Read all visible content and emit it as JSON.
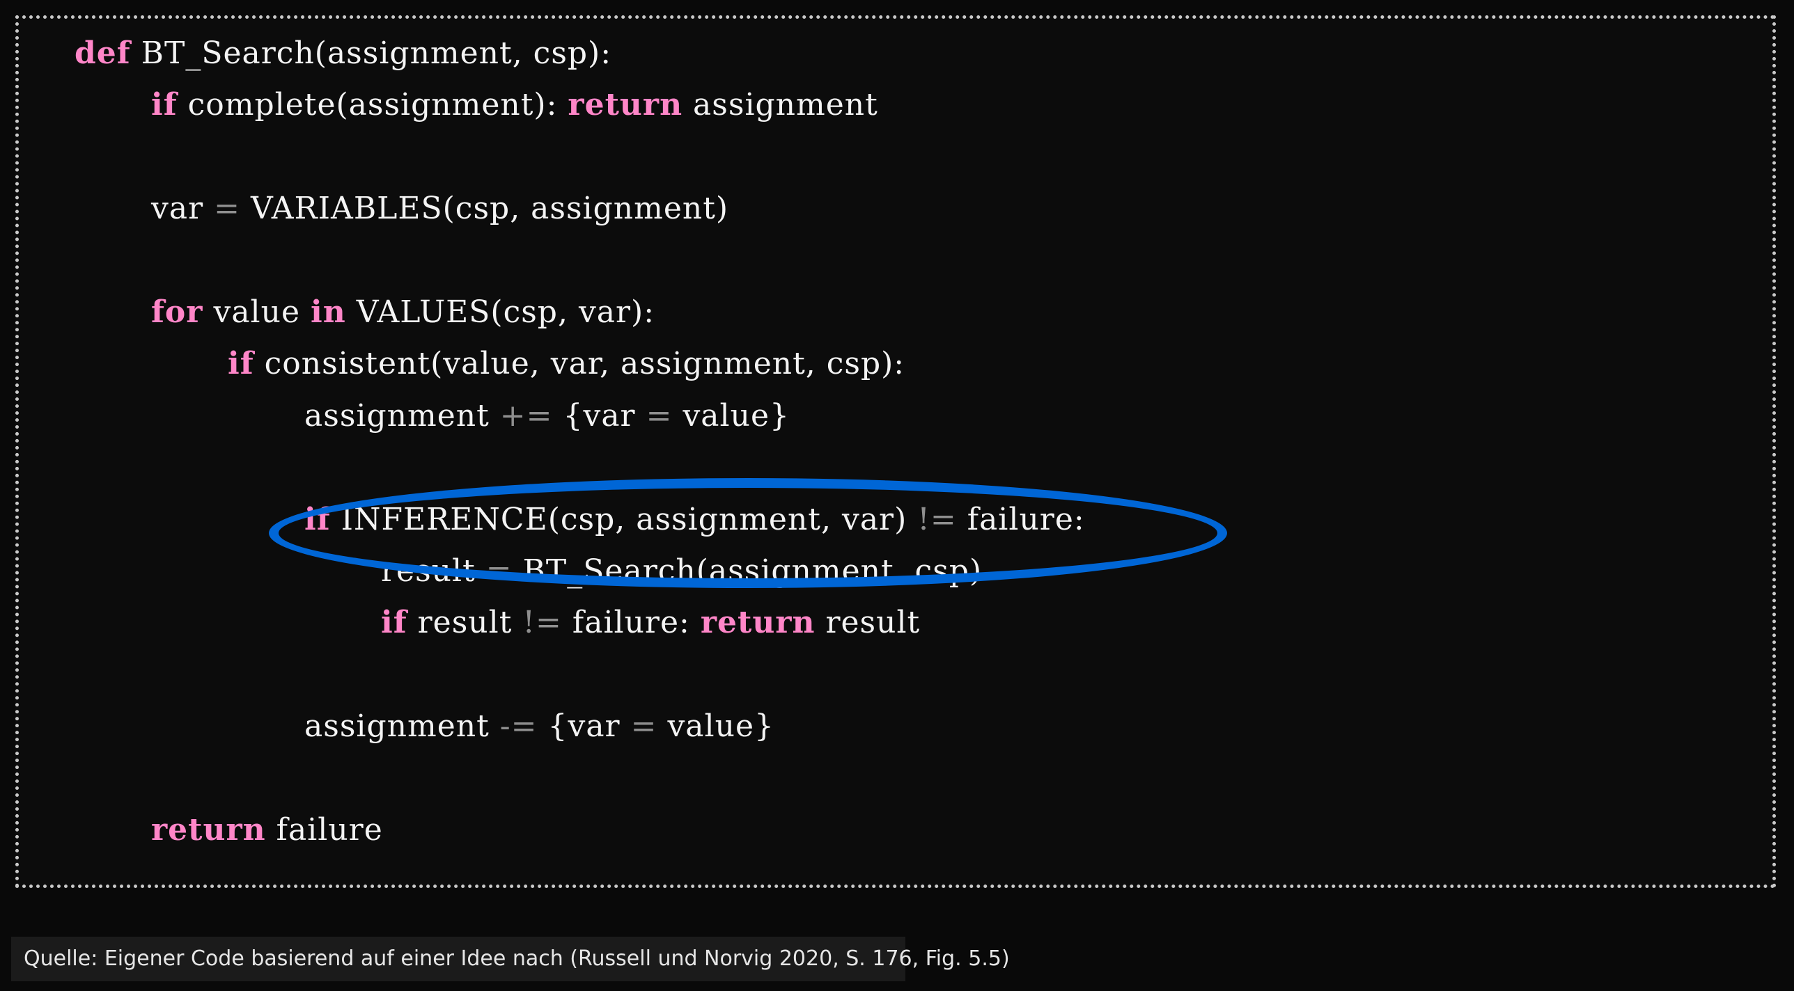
{
  "code": {
    "lines": [
      {
        "indent": 0,
        "tokens": [
          {
            "t": "kw",
            "text": "def"
          },
          {
            "t": "tx",
            "text": " BT_Search(assignment, csp):"
          }
        ]
      },
      {
        "indent": 1,
        "tokens": [
          {
            "t": "kw",
            "text": "if"
          },
          {
            "t": "tx",
            "text": " complete(assignment): "
          },
          {
            "t": "kw",
            "text": "return"
          },
          {
            "t": "tx",
            "text": " assignment"
          }
        ]
      },
      {
        "indent": 0,
        "tokens": []
      },
      {
        "indent": 1,
        "tokens": [
          {
            "t": "tx",
            "text": "var "
          },
          {
            "t": "op",
            "text": "="
          },
          {
            "t": "tx",
            "text": " VARIABLES(csp, assignment)"
          }
        ]
      },
      {
        "indent": 0,
        "tokens": []
      },
      {
        "indent": 1,
        "tokens": [
          {
            "t": "kw",
            "text": "for"
          },
          {
            "t": "tx",
            "text": " value "
          },
          {
            "t": "kw",
            "text": "in"
          },
          {
            "t": "tx",
            "text": " VALUES(csp, var):"
          }
        ]
      },
      {
        "indent": 2,
        "tokens": [
          {
            "t": "kw",
            "text": "if"
          },
          {
            "t": "tx",
            "text": " consistent(value, var, assignment, csp):"
          }
        ]
      },
      {
        "indent": 3,
        "tokens": [
          {
            "t": "tx",
            "text": "assignment "
          },
          {
            "t": "op",
            "text": "+="
          },
          {
            "t": "tx",
            "text": " {var "
          },
          {
            "t": "op",
            "text": "="
          },
          {
            "t": "tx",
            "text": " value}"
          }
        ]
      },
      {
        "indent": 0,
        "tokens": []
      },
      {
        "indent": 3,
        "tokens": [
          {
            "t": "kw",
            "text": "if"
          },
          {
            "t": "tx",
            "text": " INFERENCE(csp, assignment, var) "
          },
          {
            "t": "op",
            "text": "!="
          },
          {
            "t": "tx",
            "text": " failure:"
          }
        ]
      },
      {
        "indent": 4,
        "tokens": [
          {
            "t": "tx",
            "text": "result "
          },
          {
            "t": "op",
            "text": "="
          },
          {
            "t": "tx",
            "text": " BT_Search(assignment, csp)"
          }
        ]
      },
      {
        "indent": 4,
        "tokens": [
          {
            "t": "kw",
            "text": "if"
          },
          {
            "t": "tx",
            "text": " result "
          },
          {
            "t": "op",
            "text": "!="
          },
          {
            "t": "tx",
            "text": " failure: "
          },
          {
            "t": "kw",
            "text": "return"
          },
          {
            "t": "tx",
            "text": " result"
          }
        ]
      },
      {
        "indent": 0,
        "tokens": []
      },
      {
        "indent": 3,
        "tokens": [
          {
            "t": "tx",
            "text": "assignment "
          },
          {
            "t": "op",
            "text": "-="
          },
          {
            "t": "tx",
            "text": " {var "
          },
          {
            "t": "op",
            "text": "="
          },
          {
            "t": "tx",
            "text": " value}"
          }
        ]
      },
      {
        "indent": 0,
        "tokens": []
      },
      {
        "indent": 1,
        "tokens": [
          {
            "t": "kw",
            "text": "return"
          },
          {
            "t": "tx",
            "text": " failure"
          }
        ]
      }
    ],
    "highlighted_line": 9
  },
  "colors": {
    "keyword": "#ff86c8",
    "operator": "#8f8f8f",
    "text": "#f4f4f4",
    "highlight": "#0066d6",
    "border": "#c9c9c9"
  },
  "caption": {
    "text": "Quelle: Eigener Code basierend auf einer Idee nach (Russell und Norvig 2020, S. 176, Fig. 5.5)"
  }
}
